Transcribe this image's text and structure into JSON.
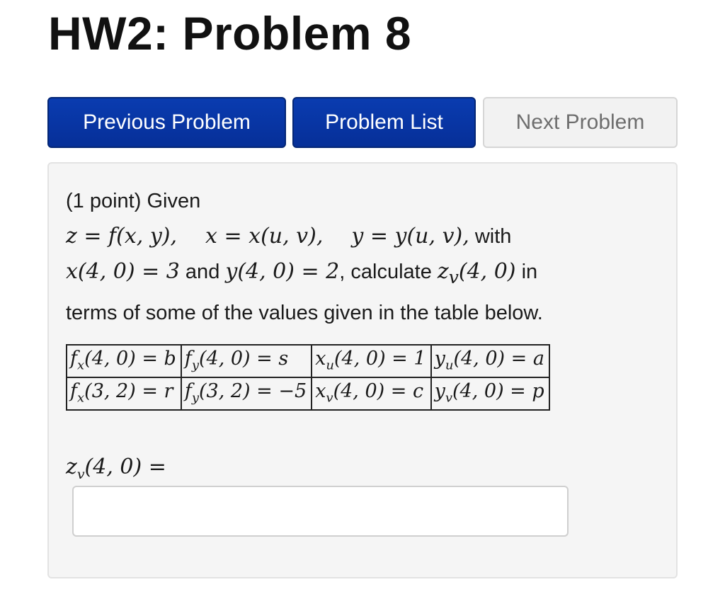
{
  "page": {
    "title": "HW2: Problem 8"
  },
  "nav": {
    "previous_label": "Previous Problem",
    "list_label": "Problem List",
    "next_label": "Next Problem"
  },
  "problem": {
    "points": "(1 point) Given",
    "eq_z": "z = f(x, y),",
    "eq_x": "x = x(u, v),",
    "eq_y": "y = y(u, v),",
    "with": " with",
    "cond_x": "x(4, 0) = 3",
    "and": " and ",
    "cond_y": "y(4, 0) = 2",
    "calculate": ", calculate ",
    "target": "z_v(4, 0)",
    "in": " in",
    "line3": "terms of some of the values given in the table below."
  },
  "table": {
    "rows": [
      [
        "f_x(4, 0) = b",
        "f_y(4, 0) = s",
        "x_u(4, 0) = 1",
        "y_u(4, 0) = a"
      ],
      [
        "f_x(3, 2) = r",
        "f_y(3, 2) = −5",
        "x_v(4, 0) = c",
        "y_v(4, 0) = p"
      ]
    ]
  },
  "answer": {
    "label": "z_v(4, 0) =",
    "value": "",
    "placeholder": ""
  },
  "colors": {
    "primary_button": "#0a3cb0",
    "disabled_button": "#f2f2f2",
    "panel_background": "#f5f5f5"
  }
}
